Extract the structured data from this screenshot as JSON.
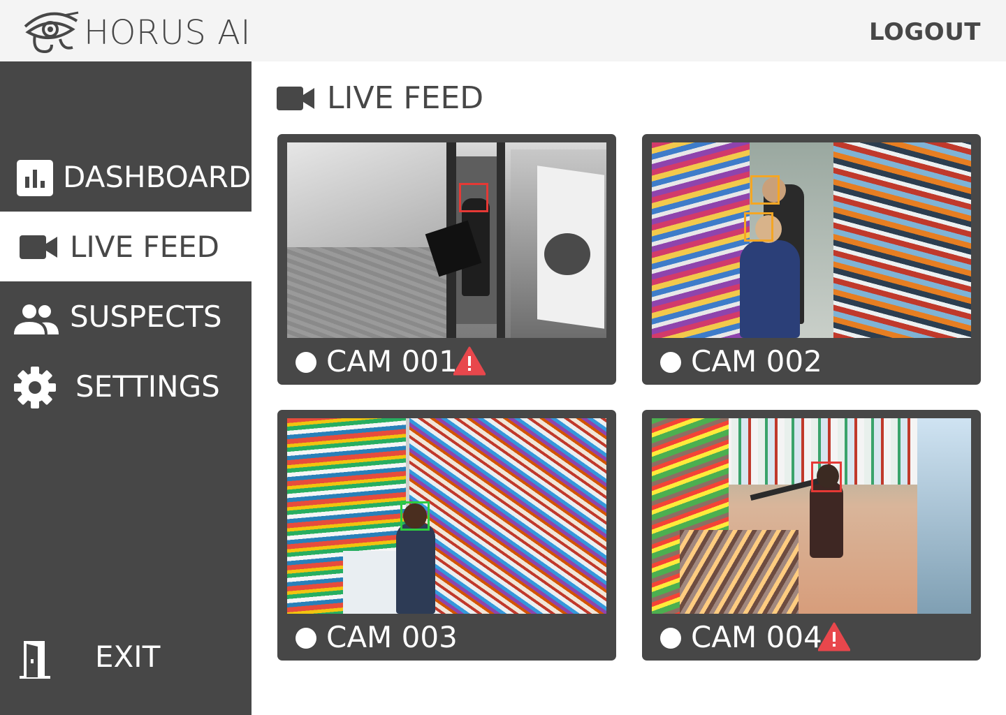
{
  "app": {
    "title": "HORUS AI",
    "logout_label": "LOGOUT"
  },
  "sidebar": {
    "items": [
      {
        "label": "DASHBOARD",
        "icon": "bar-chart-icon",
        "active": false
      },
      {
        "label": "LIVE FEED",
        "icon": "video-camera-icon",
        "active": true
      },
      {
        "label": "SUSPECTS",
        "icon": "people-icon",
        "active": false
      },
      {
        "label": "SETTINGS",
        "icon": "gear-icon",
        "active": false
      }
    ],
    "exit_label": "EXIT"
  },
  "main": {
    "title": "LIVE FEED",
    "cameras": [
      {
        "label": "CAM 001",
        "alert": true,
        "detection_colors": [
          "#e53935"
        ]
      },
      {
        "label": "CAM 002",
        "alert": false,
        "detection_colors": [
          "#f5a623",
          "#f5a623"
        ]
      },
      {
        "label": "CAM 003",
        "alert": false,
        "detection_colors": [
          "#2ecc40"
        ]
      },
      {
        "label": "CAM 004",
        "alert": true,
        "detection_colors": [
          "#e53935"
        ]
      }
    ]
  },
  "colors": {
    "panel": "#474747",
    "topbar": "#f4f4f4",
    "alert": "#e8474c"
  }
}
